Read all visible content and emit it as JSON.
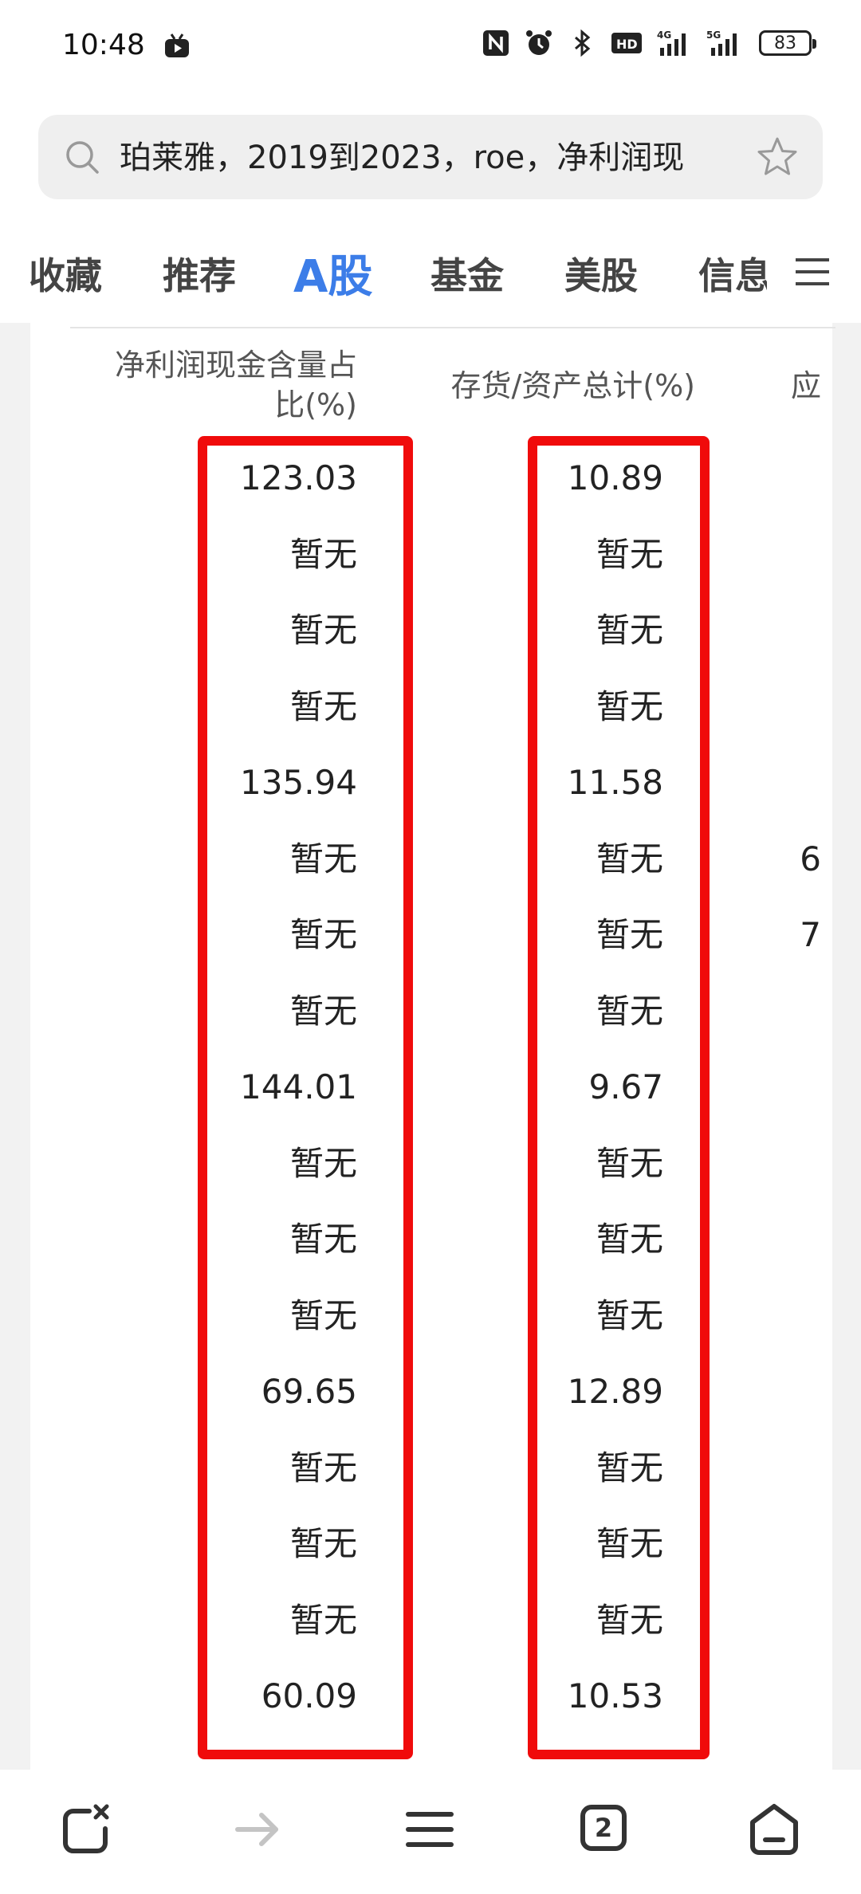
{
  "status_bar": {
    "time": "10:48",
    "battery": "83"
  },
  "search": {
    "query": "珀莱雅，2019到2023，roe，净利润现"
  },
  "tabs": [
    {
      "label": "收藏"
    },
    {
      "label": "推荐"
    },
    {
      "label": "A股"
    },
    {
      "label": "基金"
    },
    {
      "label": "美股"
    },
    {
      "label": "信息"
    }
  ],
  "table": {
    "headers": {
      "col1_line1": "净利润现金含量占",
      "col1_line2": "比(%)",
      "col2": "存货/资产总计(%)",
      "col3": "应"
    },
    "col1": [
      "123.03",
      "暂无",
      "暂无",
      "暂无",
      "135.94",
      "暂无",
      "暂无",
      "暂无",
      "144.01",
      "暂无",
      "暂无",
      "暂无",
      "69.65",
      "暂无",
      "暂无",
      "暂无",
      "60.09"
    ],
    "col2": [
      "10.89",
      "暂无",
      "暂无",
      "暂无",
      "11.58",
      "暂无",
      "暂无",
      "暂无",
      "9.67",
      "暂无",
      "暂无",
      "暂无",
      "12.89",
      "暂无",
      "暂无",
      "暂无",
      "10.53"
    ],
    "col3_partial": [
      "6",
      "7"
    ]
  },
  "bottom_nav": {
    "tab_count": "2"
  },
  "colors": {
    "accent": "#3c7de8",
    "highlight_box": "#f00b0b"
  }
}
